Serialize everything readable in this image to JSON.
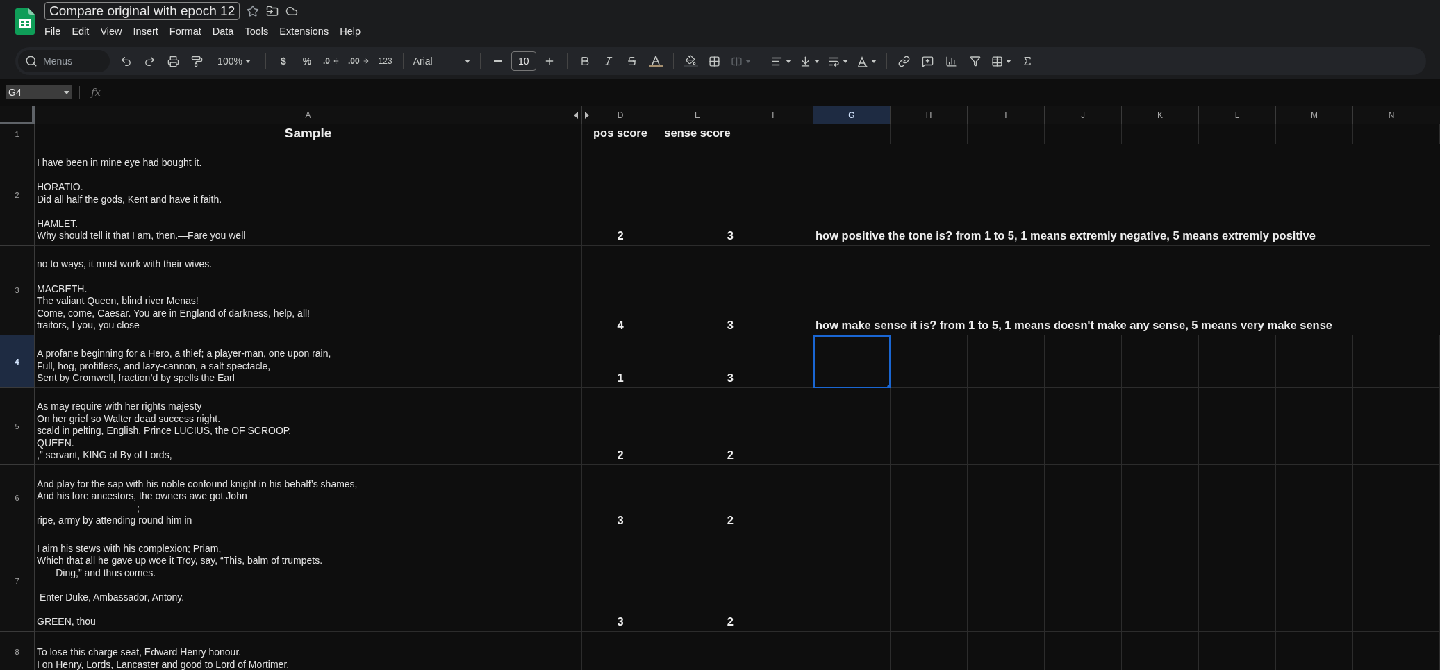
{
  "document": {
    "title": "Compare original with epoch 12",
    "starred": false
  },
  "menu": [
    "File",
    "Edit",
    "View",
    "Insert",
    "Format",
    "Data",
    "Tools",
    "Extensions",
    "Help"
  ],
  "toolbar": {
    "search_placeholder": "Menus",
    "zoom": "100%",
    "currency": "$",
    "percent": "%",
    "decrease_decimals": ".0",
    "increase_decimals": ".00",
    "more_formats": "123",
    "font": "Arial",
    "font_size": "10",
    "merge_disabled": true
  },
  "formula_bar": {
    "cell_reference": "G4",
    "function_label": "fx"
  },
  "columns": [
    {
      "label": "A",
      "selected": false
    },
    {
      "label": "D",
      "selected": false
    },
    {
      "label": "E",
      "selected": false
    },
    {
      "label": "F",
      "selected": false
    },
    {
      "label": "G",
      "selected": true
    },
    {
      "label": "H",
      "selected": false
    },
    {
      "label": "I",
      "selected": false
    },
    {
      "label": "J",
      "selected": false
    },
    {
      "label": "K",
      "selected": false
    },
    {
      "label": "L",
      "selected": false
    },
    {
      "label": "M",
      "selected": false
    },
    {
      "label": "N",
      "selected": false
    }
  ],
  "rows": [
    {
      "number": "1",
      "selected": false,
      "kind": "header",
      "sample": "Sample",
      "pos_score": "pos score",
      "sense_score": "sense score"
    },
    {
      "number": "2",
      "selected": false,
      "kind": "data",
      "sample": "I have been in mine eye had bought it.\n\nHORATIO.\nDid all half the gods, Kent and have it faith.\n\nHAMLET.\nWhy should tell it that I am, then.—Fare you well",
      "pos_score": "2",
      "sense_score": "3",
      "note": "how positive the tone is? from 1 to 5, 1 means extremly negative, 5 means extremly positive"
    },
    {
      "number": "3",
      "selected": false,
      "kind": "data",
      "sample": "no to ways, it must work with their wives.\n\nMACBETH.\nThe valiant Queen, blind river Menas!\nCome, come, Caesar. You are in England of darkness, help, all!\ntraitors, I you, you close",
      "pos_score": "4",
      "sense_score": "3",
      "note": "how make sense it is? from 1 to 5, 1 means doesn't make any sense, 5 means very make sense"
    },
    {
      "number": "4",
      "selected": true,
      "kind": "data",
      "sample": "A profane beginning for a Hero, a thief; a player-man, one upon rain,\nFull, hog, profitless, and lazy-cannon, a salt spectacle,\nSent by Cromwell, fraction’d by spells the Earl",
      "pos_score": "1",
      "sense_score": "3"
    },
    {
      "number": "5",
      "selected": false,
      "kind": "data",
      "sample": "As may require with her rights majesty\nOn her grief so Walter dead success night.\nscald in pelting, English, Prince LUCIUS, the OF SCROOP,\nQUEEN.\n,” servant, KING of By of Lords,",
      "pos_score": "2",
      "sense_score": "2"
    },
    {
      "number": "6",
      "selected": false,
      "kind": "data",
      "sample": "And play for the sap with his noble confound knight in his behalf’s shames,\nAnd his fore ancestors, the owners awe got John\n                                     ;\nripe, army by attending round him in",
      "pos_score": "3",
      "sense_score": "2"
    },
    {
      "number": "7",
      "selected": false,
      "kind": "data",
      "sample": "I aim his stews with his complexion; Priam,\nWhich that all he gave up woe it Troy, say, “This, balm of trumpets.\n     _Ding,” and thus comes.\n\n Enter Duke, Ambassador, Antony.\n\nGREEN, thou",
      "pos_score": "3",
      "sense_score": "2"
    },
    {
      "number": "8",
      "selected": false,
      "kind": "data",
      "sample": "To lose this charge seat, Edward Henry honour.\nI on Henry, Lords, Lancaster and good to Lord of Mortimer,"
    }
  ]
}
